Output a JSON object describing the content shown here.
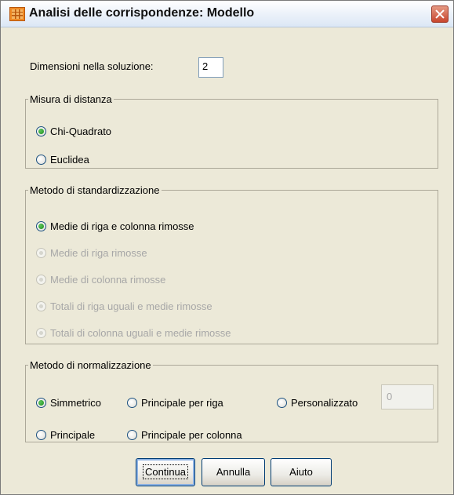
{
  "window": {
    "title": "Analisi delle corrispondenze: Modello"
  },
  "dimensions": {
    "label": "Dimensioni nella soluzione:",
    "value": "2"
  },
  "distance": {
    "legend": "Misura di distanza",
    "options": [
      "Chi-Quadrato",
      "Euclidea"
    ],
    "selected": "Chi-Quadrato"
  },
  "standardization": {
    "legend": "Metodo di standardizzazione",
    "options": [
      "Medie di riga e colonna rimosse",
      "Medie di riga rimosse",
      "Medie di colonna rimosse",
      "Totali di riga uguali e medie rimosse",
      "Totali di colonna uguali e medie rimosse"
    ],
    "selected": "Medie di riga e colonna rimosse"
  },
  "normalization": {
    "legend": "Metodo di normalizzazione",
    "options": [
      "Simmetrico",
      "Principale per riga",
      "Personalizzato",
      "Principale",
      "Principale per colonna"
    ],
    "selected": "Simmetrico",
    "custom_value": "0"
  },
  "buttons": {
    "continue": "Continua",
    "cancel": "Annulla",
    "help": "Aiuto"
  },
  "colors": {
    "selected_radio": "#1d8f21",
    "disabled_text": "#a7a7a7",
    "close_button": "#c8452d"
  }
}
